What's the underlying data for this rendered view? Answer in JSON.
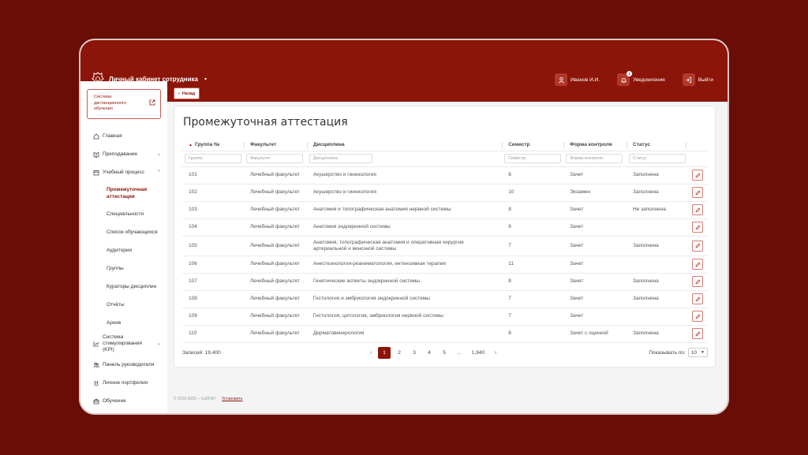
{
  "header": {
    "title": "Личный кабинет сотрудника",
    "user": "Иванов И.И.",
    "notifications_label": "Уведомления",
    "notifications_count": "1",
    "logout_label": "Выйти"
  },
  "sidebar": {
    "distance": "Система дистанционного обучения",
    "items": [
      {
        "label": "Главная",
        "icon": "home-icon"
      },
      {
        "label": "Преподавание",
        "icon": "book-icon"
      },
      {
        "label": "Учебный процесс",
        "icon": "calendar-icon"
      },
      {
        "label": "Система стимулирования (KPI)",
        "icon": "chart-icon"
      },
      {
        "label": "Панель руководителя",
        "icon": "people-icon"
      },
      {
        "label": "Личное портфолио",
        "icon": "medal-icon"
      },
      {
        "label": "Обучение",
        "icon": "briefcase-icon"
      }
    ],
    "subitems": [
      "Промежуточная аттестация",
      "Специальности",
      "Список обучающихся",
      "Аудитории",
      "Группы",
      "Кураторы дисциплин",
      "Отчёты",
      "Архив"
    ]
  },
  "back_label": "Назад",
  "page_title": "Промежуточная аттестация",
  "table": {
    "columns": [
      "Группа №",
      "Факультет",
      "Дисциплина",
      "Семестр",
      "Форма контроля",
      "Статус"
    ],
    "filters": [
      "Группа",
      "Факультет",
      "Дисциплина",
      "Семестр",
      "Форма контроля",
      "Статус"
    ],
    "rows": [
      [
        "101",
        "Лечебный факультет",
        "Акушерство и гинекология",
        "8",
        "Зачет",
        "Заполнена"
      ],
      [
        "102",
        "Лечебный факультет",
        "Акушерство и гинекология",
        "10",
        "Экзамен",
        "Заполнена"
      ],
      [
        "103",
        "Лечебный факультет",
        "Анатомия и топографическая анатомия нервной системы",
        "8",
        "Зачет",
        "Не заполнена"
      ],
      [
        "104",
        "Лечебный факультет",
        "Анатомия эндокринной системы",
        "8",
        "Зачет",
        ""
      ],
      [
        "105",
        "Лечебный факультет",
        "Анатомия, топографическая анатомия и оперативная хирургия артериальной и венозной системы",
        "7",
        "Зачет",
        "Заполнена"
      ],
      [
        "106",
        "Лечебный факультет",
        "Анестезиология-реаниматология, интенсивная терапия",
        "11",
        "Зачет",
        ""
      ],
      [
        "107",
        "Лечебный факультет",
        "Генетические аспекты эндокринной системы",
        "8",
        "Зачет",
        "Заполнена"
      ],
      [
        "108",
        "Лечебный факультет",
        "Гистология и эмбриология эндокринной системы",
        "7",
        "Зачет",
        "Заполнена"
      ],
      [
        "109",
        "Лечебный факультет",
        "Гистология, цитология, эмбриология нервной системы",
        "7",
        "Зачет",
        ""
      ],
      [
        "110",
        "Лечебный факультет",
        "Дерматовенерология",
        "8",
        "Зачет с оценкой",
        "Заполнена"
      ]
    ]
  },
  "records_label": "Записей: 19,400",
  "pagination": {
    "pages": [
      "1",
      "2",
      "3",
      "4",
      "5",
      "...",
      "1,940"
    ],
    "prev": "‹",
    "next": "›"
  },
  "show_label": "Показывать по:",
  "page_size": "10",
  "footer": {
    "copyright": "© 2019-2026 – СибГМУ",
    "install": "Установить"
  },
  "colors": {
    "brand": "#8b1508",
    "background": "#6b0d07"
  }
}
